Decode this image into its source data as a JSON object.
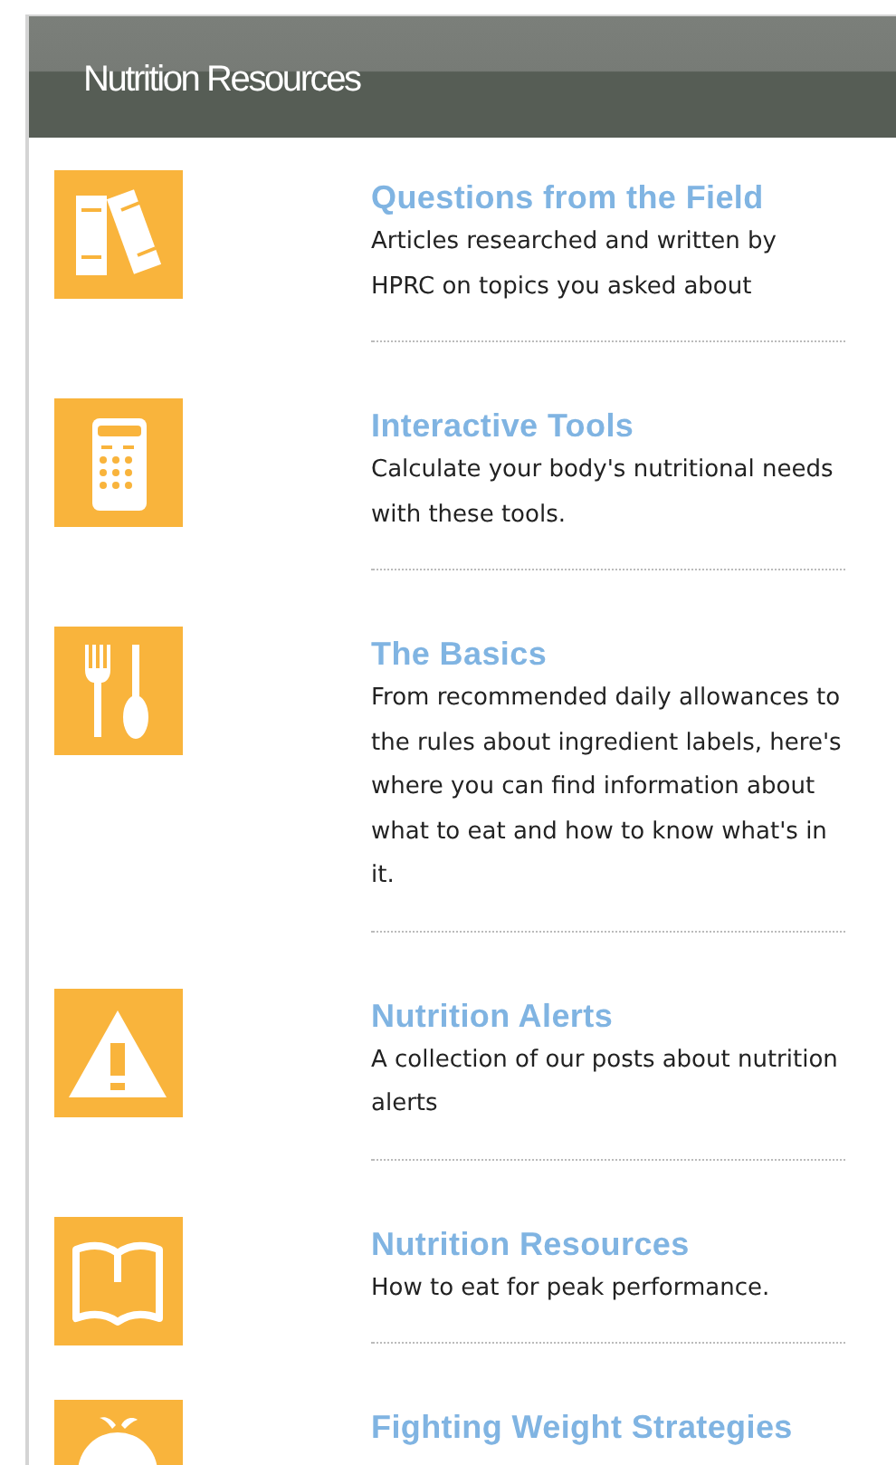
{
  "panel": {
    "title": "Nutrition Resources"
  },
  "items": [
    {
      "title": "Questions from the Field",
      "description": "Articles researched and written by HPRC on topics you asked about"
    },
    {
      "title": "Interactive Tools",
      "description": "Calculate your body's nutritional needs with these tools."
    },
    {
      "title": "The Basics",
      "description": "From recommended daily allowances to the rules about ingredient labels, here's where you can find information about what to eat and how to know what's in it."
    },
    {
      "title": "Nutrition Alerts",
      "description": "A collection of our posts about nutrition alerts"
    },
    {
      "title": "Nutrition Resources",
      "description": "How to eat for peak performance."
    },
    {
      "title": "Fighting Weight Strategies"
    }
  ]
}
